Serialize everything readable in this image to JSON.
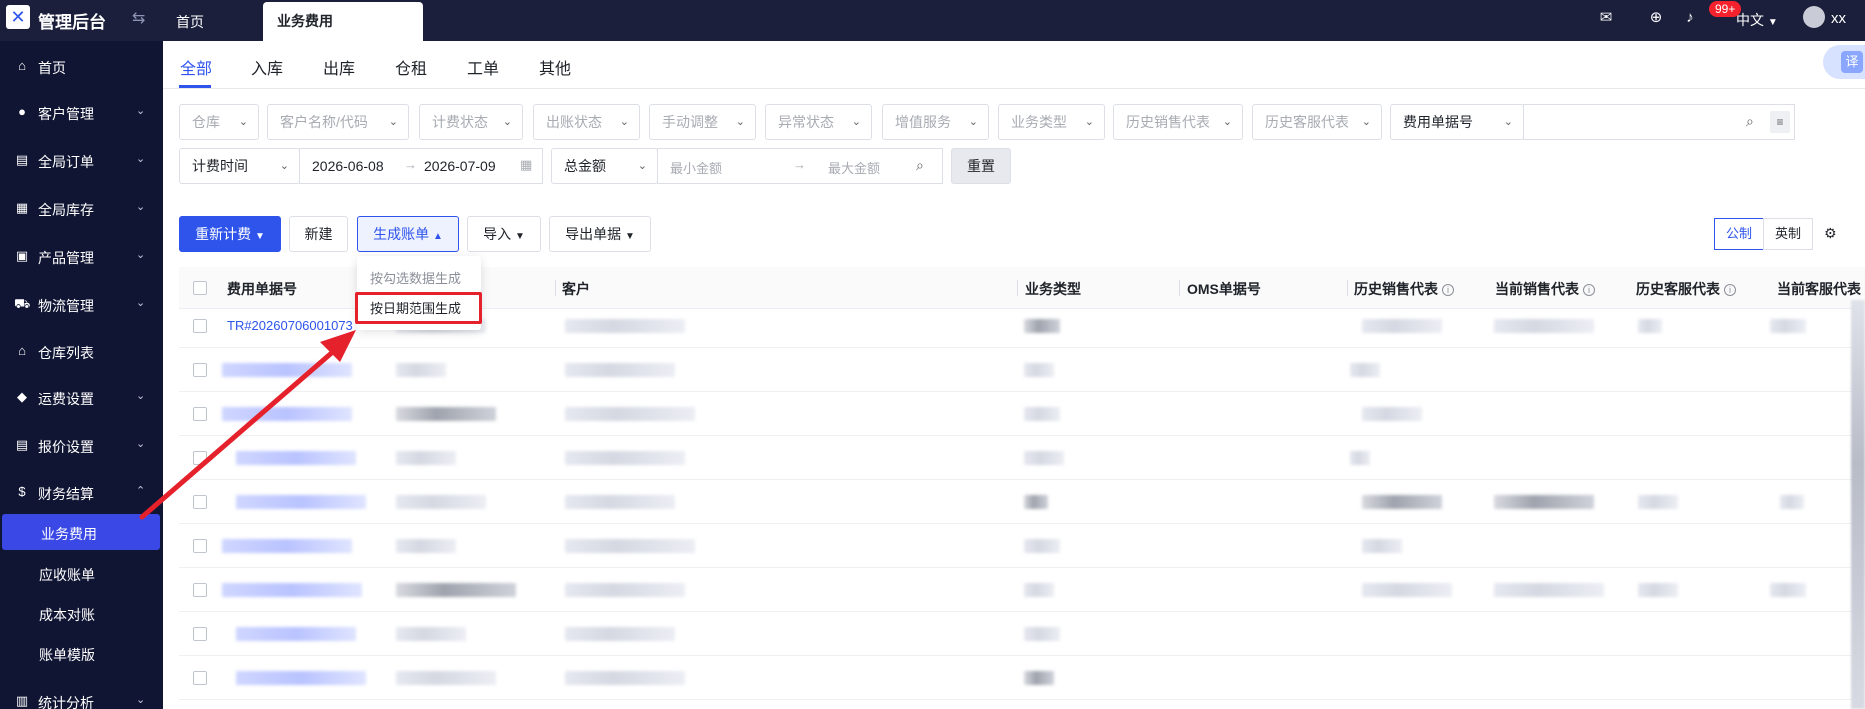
{
  "topbar": {
    "brand": "管理后台",
    "tabs": [
      {
        "label": "首页"
      },
      {
        "label": "业务费用"
      }
    ],
    "notification_count": "99+",
    "language": "中文",
    "user": "xx"
  },
  "sidebar": {
    "items": [
      {
        "label": "首页",
        "icon": "home-icon"
      },
      {
        "label": "客户管理",
        "icon": "users-icon"
      },
      {
        "label": "全局订单",
        "icon": "orders-icon"
      },
      {
        "label": "全局库存",
        "icon": "inventory-icon"
      },
      {
        "label": "产品管理",
        "icon": "product-icon"
      },
      {
        "label": "物流管理",
        "icon": "truck-icon"
      },
      {
        "label": "仓库列表",
        "icon": "warehouse-icon"
      },
      {
        "label": "运费设置",
        "icon": "freight-icon"
      },
      {
        "label": "报价设置",
        "icon": "quote-icon"
      },
      {
        "label": "财务结算",
        "icon": "finance-icon"
      },
      {
        "label": "统计分析",
        "icon": "stats-icon"
      }
    ],
    "finance_sub": [
      {
        "label": "业务费用"
      },
      {
        "label": "应收账单"
      },
      {
        "label": "成本对账"
      },
      {
        "label": "账单模版"
      }
    ]
  },
  "page_tabs": [
    "全部",
    "入库",
    "出库",
    "仓租",
    "工单",
    "其他"
  ],
  "translate_label": "译",
  "filters": {
    "row1": [
      "仓库",
      "客户名称/代码",
      "计费状态",
      "出账状态",
      "手动调整",
      "异常状态",
      "增值服务",
      "业务类型",
      "历史销售代表",
      "历史客服代表"
    ],
    "bill_no_type": "费用单据号",
    "date_type": "计费时间",
    "date_start": "2026-06-08",
    "date_end": "2026-07-09",
    "amount_type": "总金额",
    "min_amount_placeholder": "最小金额",
    "max_amount_placeholder": "最大金额",
    "reset_label": "重置"
  },
  "toolbar": {
    "recalc_label": "重新计费",
    "new_label": "新建",
    "generate_label": "生成账单",
    "import_label": "导入",
    "export_label": "导出单据",
    "unit_metric": "公制",
    "unit_imperial": "英制"
  },
  "dropdown": {
    "item_selected": "按勾选数据生成",
    "item_date_range": "按日期范围生成"
  },
  "table": {
    "headers": [
      "费用单据号",
      "客户",
      "业务类型",
      "OMS单据号",
      "历史销售代表",
      "当前销售代表",
      "历史客服代表",
      "当前客服代表"
    ],
    "first_row_bill_no": "TR#20260706001073"
  },
  "colors": {
    "topbar_bg": "#1b1f3b",
    "sidebar_bg": "#101533",
    "primary": "#2f54eb",
    "highlight_red": "#e5212b"
  }
}
